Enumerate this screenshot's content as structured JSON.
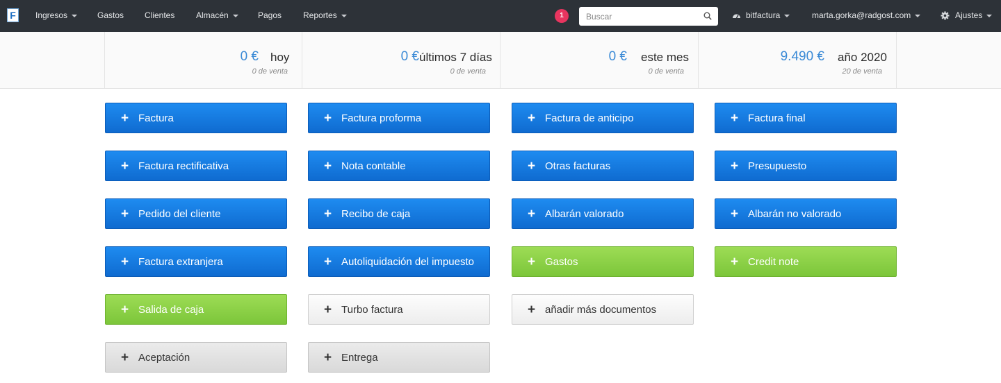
{
  "logo_letter": "F",
  "nav": {
    "items": [
      {
        "label": "Ingresos",
        "dropdown": true
      },
      {
        "label": "Gastos",
        "dropdown": false
      },
      {
        "label": "Clientes",
        "dropdown": false
      },
      {
        "label": "Almacén",
        "dropdown": true
      },
      {
        "label": "Pagos",
        "dropdown": false
      },
      {
        "label": "Reportes",
        "dropdown": true
      }
    ],
    "notification_count": "1",
    "search_placeholder": "Buscar",
    "account": "bitfactura",
    "user_email": "marta.gorka@radgost.com",
    "settings": "Ajustes"
  },
  "stats": [
    {
      "value": "0 €",
      "period": "hoy",
      "sub": "0 de venta"
    },
    {
      "value": "0 €",
      "period": "últimos 7 días",
      "sub": "0 de venta"
    },
    {
      "value": "0 €",
      "period": "este mes",
      "sub": "0 de venta"
    },
    {
      "value": "9.490 €",
      "period": "año 2020",
      "sub": "20 de venta"
    }
  ],
  "buttons": {
    "plus": "+",
    "items": [
      {
        "label": "Factura",
        "style": "blue"
      },
      {
        "label": "Factura proforma",
        "style": "blue"
      },
      {
        "label": "Factura de anticipo",
        "style": "blue"
      },
      {
        "label": "Factura final",
        "style": "blue"
      },
      {
        "label": "Factura rectificativa",
        "style": "blue"
      },
      {
        "label": "Nota contable",
        "style": "blue"
      },
      {
        "label": "Otras facturas",
        "style": "blue"
      },
      {
        "label": "Presupuesto",
        "style": "blue"
      },
      {
        "label": "Pedido del cliente",
        "style": "blue"
      },
      {
        "label": "Recibo de caja",
        "style": "blue"
      },
      {
        "label": "Albarán valorado",
        "style": "blue"
      },
      {
        "label": "Albarán no valorado",
        "style": "blue"
      },
      {
        "label": "Factura extranjera",
        "style": "blue"
      },
      {
        "label": "Autoliquidación del impuesto",
        "style": "blue"
      },
      {
        "label": "Gastos",
        "style": "green"
      },
      {
        "label": "Credit note",
        "style": "green"
      },
      {
        "label": "Salida de caja",
        "style": "green"
      },
      {
        "label": "Turbo factura",
        "style": "light"
      },
      {
        "label": "añadir más documentos",
        "style": "light"
      },
      {
        "label": "Aceptación",
        "style": "gray"
      },
      {
        "label": "Entrega",
        "style": "gray"
      }
    ]
  },
  "colors": {
    "navbar": "#2d3238",
    "primary_blue": "#1e8bf0",
    "green": "#8dd14a",
    "badge": "#e8355f",
    "stat_value": "#3a8ad6"
  }
}
